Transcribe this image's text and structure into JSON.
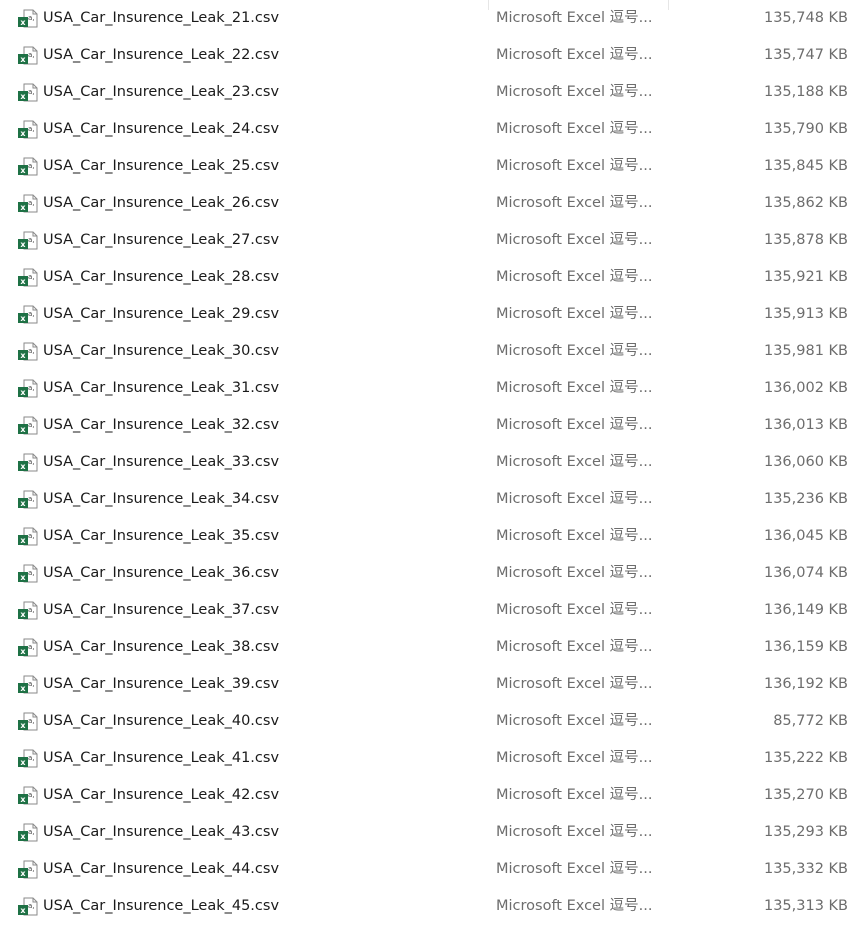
{
  "files": [
    {
      "name": "USA_Car_Insurence_Leak_21.csv",
      "type": "Microsoft Excel 逗号...",
      "size": "135,748 KB"
    },
    {
      "name": "USA_Car_Insurence_Leak_22.csv",
      "type": "Microsoft Excel 逗号...",
      "size": "135,747 KB"
    },
    {
      "name": "USA_Car_Insurence_Leak_23.csv",
      "type": "Microsoft Excel 逗号...",
      "size": "135,188 KB"
    },
    {
      "name": "USA_Car_Insurence_Leak_24.csv",
      "type": "Microsoft Excel 逗号...",
      "size": "135,790 KB"
    },
    {
      "name": "USA_Car_Insurence_Leak_25.csv",
      "type": "Microsoft Excel 逗号...",
      "size": "135,845 KB"
    },
    {
      "name": "USA_Car_Insurence_Leak_26.csv",
      "type": "Microsoft Excel 逗号...",
      "size": "135,862 KB"
    },
    {
      "name": "USA_Car_Insurence_Leak_27.csv",
      "type": "Microsoft Excel 逗号...",
      "size": "135,878 KB"
    },
    {
      "name": "USA_Car_Insurence_Leak_28.csv",
      "type": "Microsoft Excel 逗号...",
      "size": "135,921 KB"
    },
    {
      "name": "USA_Car_Insurence_Leak_29.csv",
      "type": "Microsoft Excel 逗号...",
      "size": "135,913 KB"
    },
    {
      "name": "USA_Car_Insurence_Leak_30.csv",
      "type": "Microsoft Excel 逗号...",
      "size": "135,981 KB"
    },
    {
      "name": "USA_Car_Insurence_Leak_31.csv",
      "type": "Microsoft Excel 逗号...",
      "size": "136,002 KB"
    },
    {
      "name": "USA_Car_Insurence_Leak_32.csv",
      "type": "Microsoft Excel 逗号...",
      "size": "136,013 KB"
    },
    {
      "name": "USA_Car_Insurence_Leak_33.csv",
      "type": "Microsoft Excel 逗号...",
      "size": "136,060 KB"
    },
    {
      "name": "USA_Car_Insurence_Leak_34.csv",
      "type": "Microsoft Excel 逗号...",
      "size": "135,236 KB"
    },
    {
      "name": "USA_Car_Insurence_Leak_35.csv",
      "type": "Microsoft Excel 逗号...",
      "size": "136,045 KB"
    },
    {
      "name": "USA_Car_Insurence_Leak_36.csv",
      "type": "Microsoft Excel 逗号...",
      "size": "136,074 KB"
    },
    {
      "name": "USA_Car_Insurence_Leak_37.csv",
      "type": "Microsoft Excel 逗号...",
      "size": "136,149 KB"
    },
    {
      "name": "USA_Car_Insurence_Leak_38.csv",
      "type": "Microsoft Excel 逗号...",
      "size": "136,159 KB"
    },
    {
      "name": "USA_Car_Insurence_Leak_39.csv",
      "type": "Microsoft Excel 逗号...",
      "size": "136,192 KB"
    },
    {
      "name": "USA_Car_Insurence_Leak_40.csv",
      "type": "Microsoft Excel 逗号...",
      "size": "85,772 KB"
    },
    {
      "name": "USA_Car_Insurence_Leak_41.csv",
      "type": "Microsoft Excel 逗号...",
      "size": "135,222 KB"
    },
    {
      "name": "USA_Car_Insurence_Leak_42.csv",
      "type": "Microsoft Excel 逗号...",
      "size": "135,270 KB"
    },
    {
      "name": "USA_Car_Insurence_Leak_43.csv",
      "type": "Microsoft Excel 逗号...",
      "size": "135,293 KB"
    },
    {
      "name": "USA_Car_Insurence_Leak_44.csv",
      "type": "Microsoft Excel 逗号...",
      "size": "135,332 KB"
    },
    {
      "name": "USA_Car_Insurence_Leak_45.csv",
      "type": "Microsoft Excel 逗号...",
      "size": "135,313 KB"
    }
  ],
  "icons": {
    "file": "excel-csv-file-icon"
  },
  "colors": {
    "excel_green": "#1e7145",
    "text_primary": "#1a1a1a",
    "text_secondary": "#6d6d6d"
  }
}
